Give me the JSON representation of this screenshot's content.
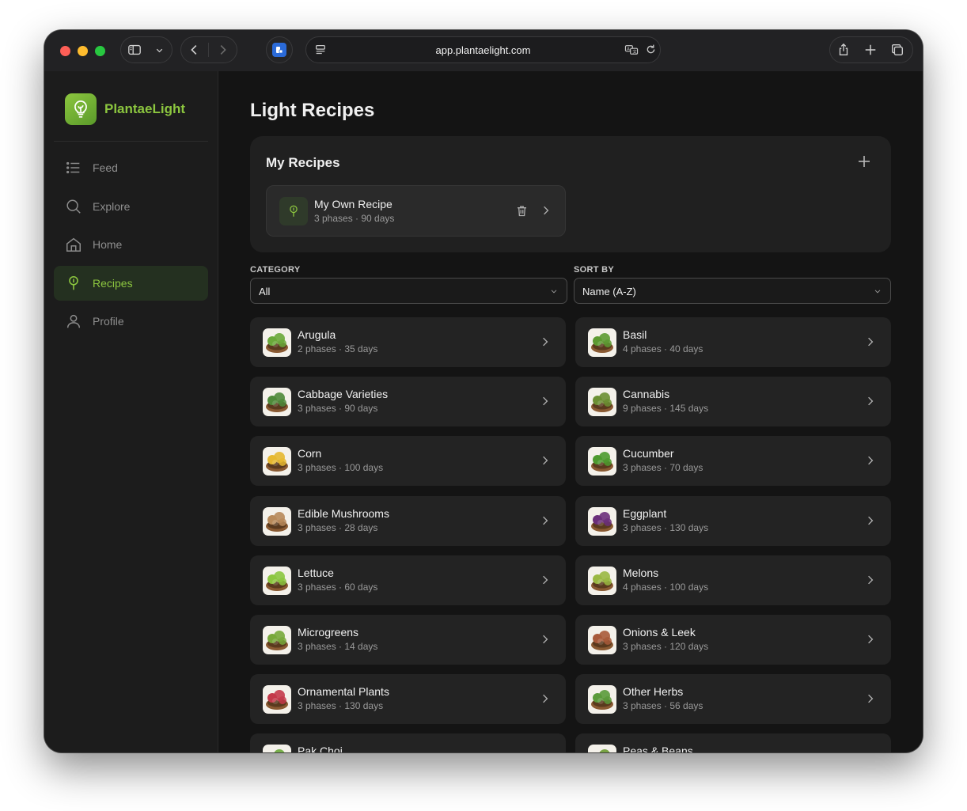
{
  "browser": {
    "url": "app.plantaelight.com"
  },
  "sidebar": {
    "brand": "PlantaeLight",
    "items": [
      {
        "label": "Feed",
        "icon": "list-icon",
        "active": false
      },
      {
        "label": "Explore",
        "icon": "search-icon",
        "active": false
      },
      {
        "label": "Home",
        "icon": "home-icon",
        "active": false
      },
      {
        "label": "Recipes",
        "icon": "lightbulb-icon",
        "active": true
      },
      {
        "label": "Profile",
        "icon": "user-icon",
        "active": false
      }
    ]
  },
  "main": {
    "title": "Light Recipes",
    "my_recipes": {
      "heading": "My Recipes",
      "items": [
        {
          "name": "My Own Recipe",
          "meta": "3 phases · 90 days"
        }
      ]
    },
    "filters": {
      "category_label": "CATEGORY",
      "category_value": "All",
      "sort_label": "SORT BY",
      "sort_value": "Name (A-Z)"
    },
    "recipes": [
      {
        "name": "Arugula",
        "meta": "2 phases · 35 days",
        "color": "#6aa83a"
      },
      {
        "name": "Basil",
        "meta": "4 phases · 40 days",
        "color": "#5d9a32"
      },
      {
        "name": "Cabbage Varieties",
        "meta": "3 phases · 90 days",
        "color": "#4f8a3a"
      },
      {
        "name": "Cannabis",
        "meta": "9 phases · 145 days",
        "color": "#6b8f33"
      },
      {
        "name": "Corn",
        "meta": "3 phases · 100 days",
        "color": "#e6b830"
      },
      {
        "name": "Cucumber",
        "meta": "3 phases · 70 days",
        "color": "#4d9a2e"
      },
      {
        "name": "Edible Mushrooms",
        "meta": "3 phases · 28 days",
        "color": "#b88a5a"
      },
      {
        "name": "Eggplant",
        "meta": "3 phases · 130 days",
        "color": "#6b2f7a"
      },
      {
        "name": "Lettuce",
        "meta": "3 phases · 60 days",
        "color": "#8cc63f"
      },
      {
        "name": "Melons",
        "meta": "4 phases · 100 days",
        "color": "#9ab842"
      },
      {
        "name": "Microgreens",
        "meta": "3 phases · 14 days",
        "color": "#78a83a"
      },
      {
        "name": "Onions & Leek",
        "meta": "3 phases · 120 days",
        "color": "#a85a3a"
      },
      {
        "name": "Ornamental Plants",
        "meta": "3 phases · 130 days",
        "color": "#c43a4a"
      },
      {
        "name": "Other Herbs",
        "meta": "3 phases · 56 days",
        "color": "#5a9a3a"
      },
      {
        "name": "Pak Choi",
        "meta": "",
        "color": "#6aa83a"
      },
      {
        "name": "Peas & Beans",
        "meta": "",
        "color": "#6a9a32"
      }
    ]
  }
}
